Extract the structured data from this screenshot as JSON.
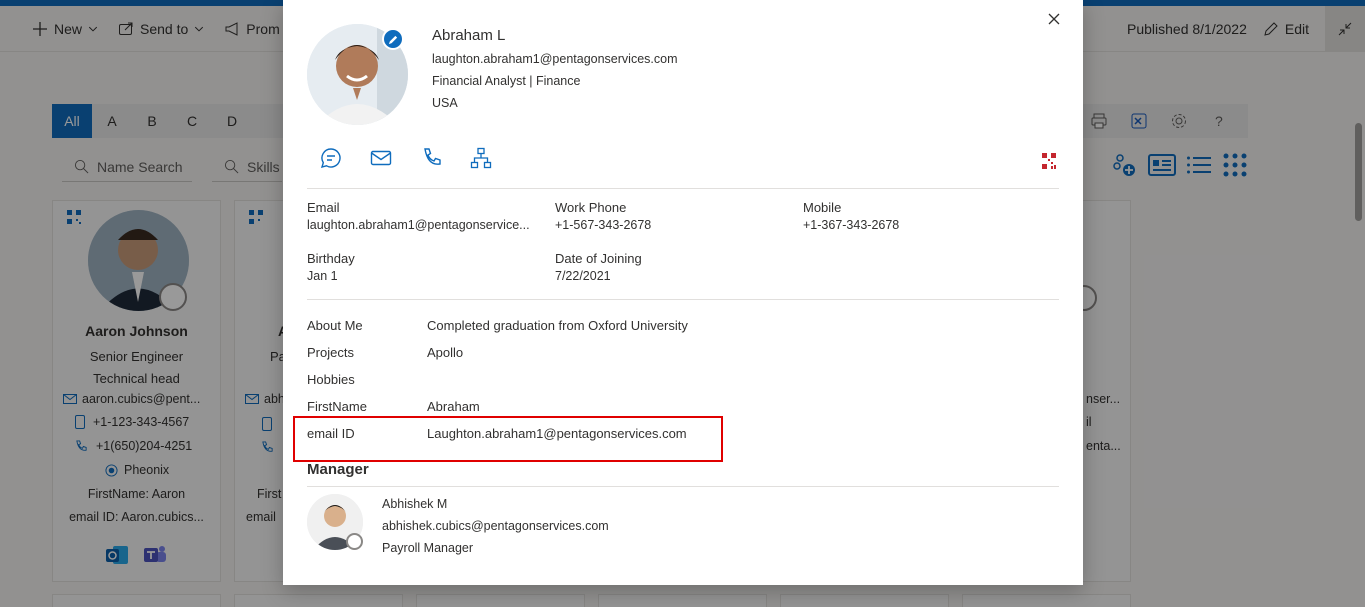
{
  "toolbar": {
    "new_label": "New",
    "send_to_label": "Send to",
    "promote_label": "Prom",
    "published_label": "Published 8/1/2022",
    "edit_label": "Edit"
  },
  "alphabet": {
    "items": [
      "All",
      "A",
      "B",
      "C",
      "D"
    ],
    "active": "All"
  },
  "search": {
    "name_placeholder": "Name Search",
    "skills_placeholder": "Skills"
  },
  "background_card": {
    "name": "Aaron Johnson",
    "title": "Senior Engineer",
    "role": "Technical head",
    "email": "aaron.cubics@pent...",
    "mobile": "+1-123-343-4567",
    "phone": "+1(650)204-4251",
    "location": "Pheonix",
    "first_name": "FirstName: Aaron",
    "email_id": "email ID: Aaron.cubics..."
  },
  "partial_card_2": {
    "initial": "A",
    "pa": "Pa",
    "email": "abh",
    "first": "First",
    "email_id": "email"
  },
  "partial_card_right": {
    "email": "nser...",
    "mobile": "il",
    "phone": "enta..."
  },
  "profile": {
    "name": "Abraham L",
    "email": "laughton.abraham1@pentagonservices.com",
    "job": "Financial Analyst | Finance",
    "country": "USA"
  },
  "details": {
    "email_label": "Email",
    "email_value": "laughton.abraham1@pentagonservice...",
    "work_phone_label": "Work Phone",
    "work_phone_value": "+1-567-343-2678",
    "mobile_label": "Mobile",
    "mobile_value": "+1-367-343-2678",
    "birthday_label": "Birthday",
    "birthday_value": "Jan 1",
    "doj_label": "Date of Joining",
    "doj_value": "7/22/2021"
  },
  "about": {
    "about_label": "About Me",
    "about_value": "Completed graduation from Oxford University",
    "projects_label": "Projects",
    "projects_value": "Apollo",
    "hobbies_label": "Hobbies",
    "hobbies_value": "",
    "firstname_label": "FirstName",
    "firstname_value": "Abraham",
    "emailid_label": "email ID",
    "emailid_value": "Laughton.abraham1@pentagonservices.com"
  },
  "manager": {
    "heading": "Manager",
    "name": "Abhishek M",
    "email": "abhishek.cubics@pentagonservices.com",
    "title": "Payroll Manager"
  },
  "colors": {
    "accent": "#0f6cbd",
    "highlight": "#e00000"
  }
}
